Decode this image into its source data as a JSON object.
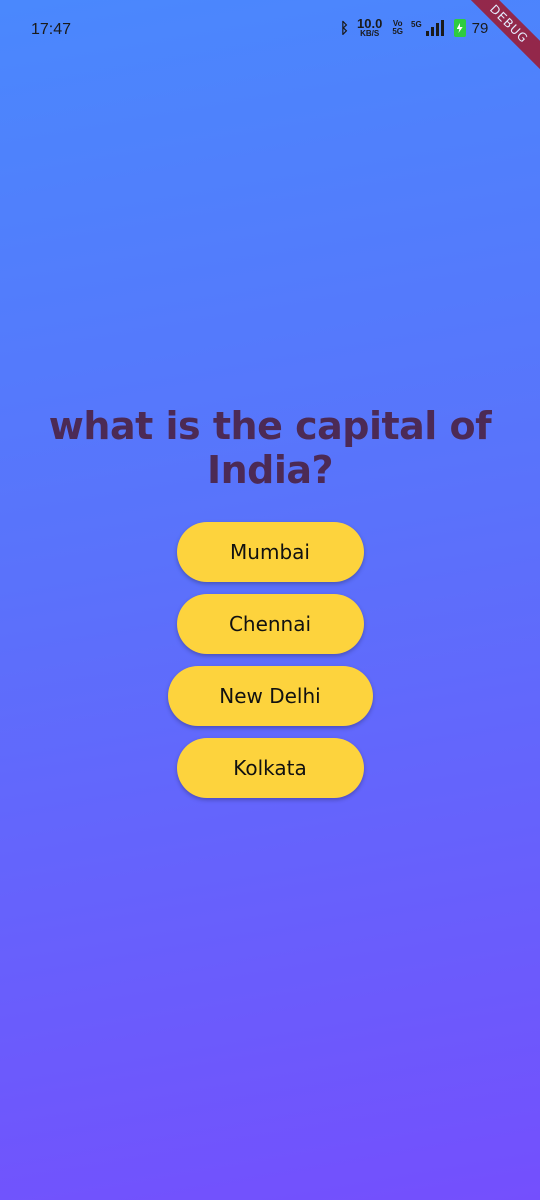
{
  "status_bar": {
    "time": "17:47",
    "bluetooth_icon": "bluetooth-icon",
    "net_speed_value": "10.0",
    "net_speed_unit": "KB/S",
    "volte_top": "Vo",
    "volte_bottom": "5G",
    "network_type": "5G",
    "signal_icon": "signal-bars-icon",
    "battery_icon": "battery-charging-icon",
    "battery_level": "79"
  },
  "debug_banner": "DEBUG",
  "quiz": {
    "question": "what is the capital of India?",
    "answers": [
      "Mumbai",
      "Chennai",
      "New Delhi",
      "Kolkata"
    ]
  },
  "colors": {
    "background_top": "#4a88fd",
    "background_bottom": "#744ffd",
    "button": "#fdd33d",
    "question_text": "#4c2a55"
  }
}
